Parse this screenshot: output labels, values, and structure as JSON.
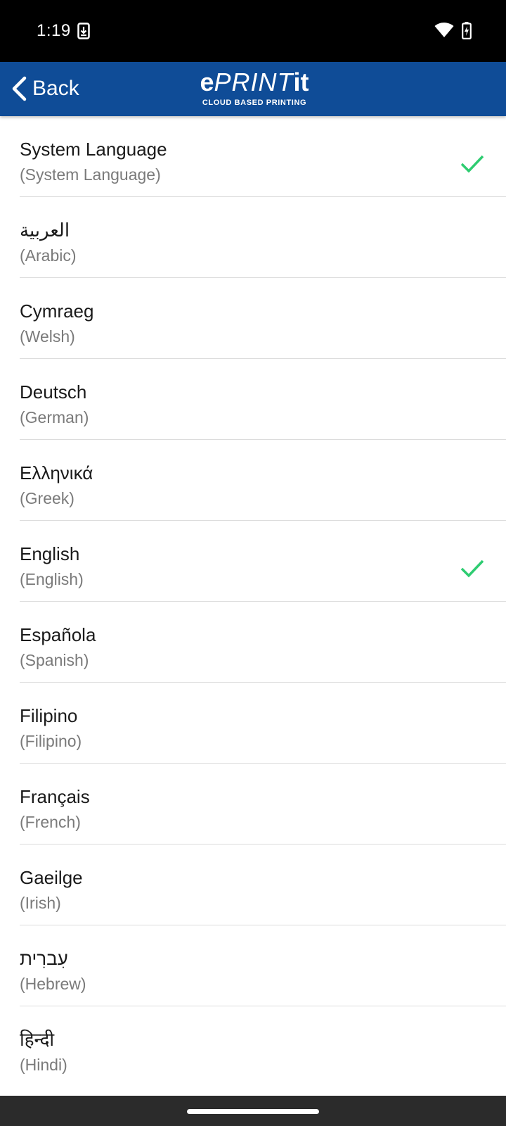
{
  "status_bar": {
    "time": "1:19",
    "icons": [
      "download-icon",
      "wifi-icon",
      "battery-charging-icon"
    ]
  },
  "app_bar": {
    "back_label": "Back",
    "logo_prefix": "e",
    "logo_middle": "PRINT",
    "logo_suffix": "it",
    "logo_tagline": "CLOUD BASED PRINTING",
    "background_color": "#0f4c97"
  },
  "languages": [
    {
      "native": "System Language",
      "english": "(System Language)",
      "selected": true
    },
    {
      "native": "العربية",
      "english": "(Arabic)",
      "selected": false
    },
    {
      "native": "Cymraeg",
      "english": "(Welsh)",
      "selected": false
    },
    {
      "native": "Deutsch",
      "english": "(German)",
      "selected": false
    },
    {
      "native": "Ελληνικά",
      "english": "(Greek)",
      "selected": false
    },
    {
      "native": "English",
      "english": "(English)",
      "selected": true
    },
    {
      "native": "Española",
      "english": "(Spanish)",
      "selected": false
    },
    {
      "native": "Filipino",
      "english": "(Filipino)",
      "selected": false
    },
    {
      "native": "Français",
      "english": "(French)",
      "selected": false
    },
    {
      "native": "Gaeilge",
      "english": "(Irish)",
      "selected": false
    },
    {
      "native": "עִברִית",
      "english": "(Hebrew)",
      "selected": false
    },
    {
      "native": "हिन्दी",
      "english": "(Hindi)",
      "selected": false
    }
  ],
  "colors": {
    "check": "#2ecc71",
    "primary_text": "#1a1a1a",
    "secondary_text": "#7a7a7a"
  }
}
